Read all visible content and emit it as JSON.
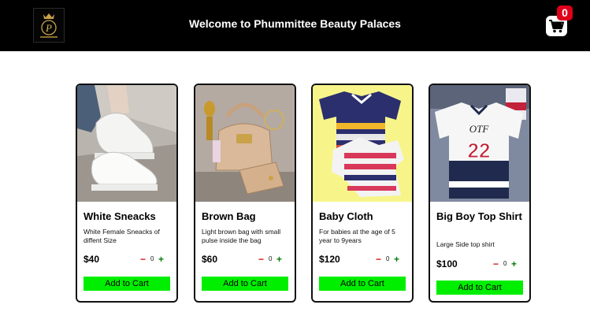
{
  "header": {
    "title": "Welcome to Phummittee Beauty Palaces",
    "logo_icon": "crown-monogram-logo",
    "background": "#000000"
  },
  "cart": {
    "icon": "shopping-cart-icon",
    "count": "0",
    "badge_color": "#e0001a"
  },
  "products": [
    {
      "name": "White Sneacks",
      "description": "White Female Sneacks of diffent Size",
      "price": "$40",
      "quantity": "0",
      "button_label": "Add to Cart"
    },
    {
      "name": "Brown Bag",
      "description": "Light brown bag with small pulse inside the bag",
      "price": "$60",
      "quantity": "0",
      "button_label": "Add to Cart"
    },
    {
      "name": "Baby Cloth",
      "description": "For babies at the age of 5 year to 9years",
      "price": "$120",
      "quantity": "0",
      "button_label": "Add to Cart"
    },
    {
      "name": "Big Boy Top Shirt",
      "description": "Large Side top shirt",
      "price": "$100",
      "quantity": "0",
      "button_label": "Add to Cart"
    }
  ],
  "controls": {
    "minus_symbol": "−",
    "plus_symbol": "+"
  },
  "colors": {
    "add_button": "#00ef00",
    "minus": "#d01010",
    "plus": "#0a7a0a"
  }
}
